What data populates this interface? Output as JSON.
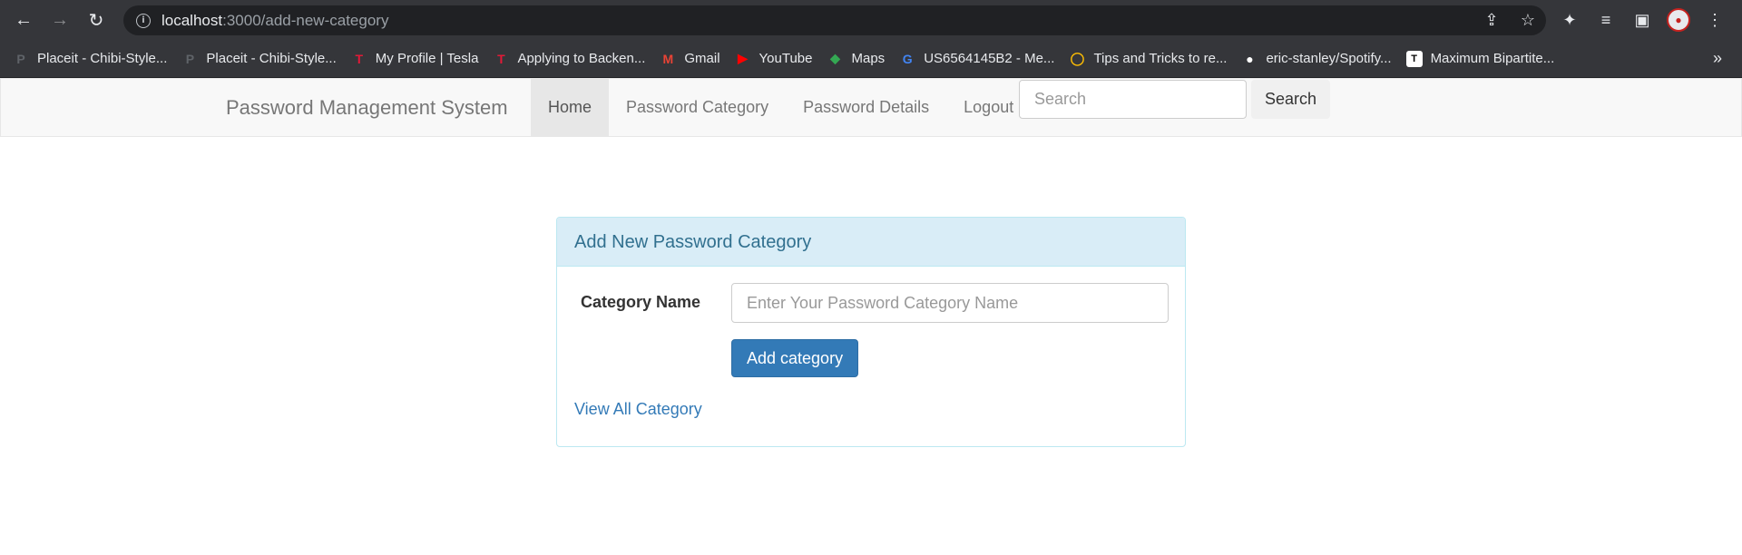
{
  "browser": {
    "url_host": "localhost",
    "url_path": ":3000/add-new-category",
    "bookmarks": [
      {
        "label": "Placeit - Chibi-Style...",
        "icon": "placeit-icon",
        "color": "#5f6368",
        "glyph": "P"
      },
      {
        "label": "Placeit - Chibi-Style...",
        "icon": "placeit-icon",
        "color": "#5f6368",
        "glyph": "P"
      },
      {
        "label": "My Profile | Tesla",
        "icon": "tesla-icon",
        "color": "#e31937",
        "glyph": "T"
      },
      {
        "label": "Applying to Backen...",
        "icon": "tesla-icon",
        "color": "#e31937",
        "glyph": "T"
      },
      {
        "label": "Gmail",
        "icon": "gmail-icon",
        "color": "#ea4335",
        "glyph": "M"
      },
      {
        "label": "YouTube",
        "icon": "youtube-icon",
        "color": "#ff0000",
        "glyph": "▶"
      },
      {
        "label": "Maps",
        "icon": "maps-icon",
        "color": "#34a853",
        "glyph": "◆"
      },
      {
        "label": "US6564145B2 - Me...",
        "icon": "google-icon",
        "color": "#4285f4",
        "glyph": "G"
      },
      {
        "label": "Tips and Tricks to re...",
        "icon": "ring-icon",
        "color": "#fbbc04",
        "glyph": "◯"
      },
      {
        "label": "eric-stanley/Spotify...",
        "icon": "github-icon",
        "color": "#ffffff",
        "glyph": "●"
      },
      {
        "label": "Maximum Bipartite...",
        "icon": "tih-icon",
        "color": "#ffffff",
        "glyph": "T"
      }
    ],
    "overflow_label": "»"
  },
  "navbar": {
    "brand": "Password Management System",
    "links": [
      "Home",
      "Password Category",
      "Password Details",
      "Logout"
    ],
    "search_placeholder": "Search",
    "search_button": "Search"
  },
  "panel": {
    "heading": "Add New Password Category",
    "field_label": "Category Name",
    "field_placeholder": "Enter Your Password Category Name",
    "submit_label": "Add category",
    "view_all_label": "View All Category"
  }
}
